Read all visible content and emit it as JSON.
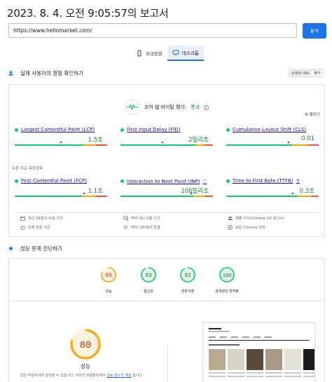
{
  "report": {
    "title": "2023. 8. 4. 오전 9:05:57의 보고서"
  },
  "url_input": {
    "value": "https://www.hellomarket.com/"
  },
  "analyze_label": "분석",
  "device_tabs": [
    {
      "label": "휴대전화",
      "icon": "smartphone-icon",
      "active": false
    },
    {
      "label": "데스크톱",
      "icon": "desktop-icon",
      "active": true
    }
  ],
  "real_user": {
    "title": "실제 사용자의 경험 확인하기",
    "toggle": [
      "요청된 URL",
      "출처"
    ],
    "cwv_label": "코어 웹 바이탈 평가:",
    "cwv_result": "통과",
    "expand": "뷰 펼치기",
    "other_label": "다른 주요 측정항목",
    "metrics": [
      {
        "name": "Largest Contentful Paint (LCP)",
        "value": "1.5초",
        "good": 0.75,
        "ni": 0.13,
        "poor": 0.12,
        "marker": 0.5
      },
      {
        "name": "First Input Delay (FID)",
        "value": "2밀리초",
        "good": 0.82,
        "ni": 0.09,
        "poor": 0.09,
        "marker": 0.46
      },
      {
        "name": "Cumulative Layout Shift (CLS)",
        "value": "0.01",
        "good": 0.71,
        "ni": 0.17,
        "poor": 0.12,
        "marker": 0.68
      },
      {
        "name": "First Contentful Paint (FCP)",
        "value": "1.1초",
        "good": 0.73,
        "ni": 0.14,
        "poor": 0.13,
        "marker": 0.75
      },
      {
        "name": "Interaction to Next Paint (INP)",
        "value": "106밀리초",
        "good": 0.79,
        "ni": 0.12,
        "poor": 0.09,
        "marker": 0.77
      },
      {
        "name": "Time to First Byte (TTFB)",
        "value": "0.3초",
        "good": 0.78,
        "ni": 0.14,
        "poor": 0.08,
        "marker": 0.72
      }
    ],
    "footer": [
      {
        "icon": "calendar-icon",
        "text": "최근 28일의 수집 기간"
      },
      {
        "icon": "devices-icon",
        "text": "여러 데스크톱 기기"
      },
      {
        "icon": "people-icon",
        "text": "샘플 다수(Chrome UX 보고서)"
      },
      {
        "icon": "timer-icon",
        "text": "전체 방문 시간"
      },
      {
        "icon": "wifi-icon",
        "text": "여러 네트워크 연결"
      },
      {
        "icon": "chrome-icon",
        "text": "모든 Chrome 버전"
      }
    ]
  },
  "diagnose": {
    "title": "성능 문제 진단하기",
    "gauges": [
      {
        "score": "80",
        "label": "성능",
        "color": "#c33300",
        "fill": 0.8,
        "ring": "#ffa400",
        "bg": "#fff3e0"
      },
      {
        "score": "93",
        "label": "접근성",
        "color": "#0d7a37",
        "fill": 0.93,
        "ring": "#0cce6b",
        "bg": "#e6f4ea"
      },
      {
        "score": "92",
        "label": "권장사항",
        "color": "#0d7a37",
        "fill": 0.92,
        "ring": "#0cce6b",
        "bg": "#e6f4ea"
      },
      {
        "score": "100",
        "label": "검색엔진 최적화",
        "color": "#0d7a37",
        "fill": 1.0,
        "ring": "#0cce6b",
        "bg": "#e6f4ea"
      }
    ],
    "big_score": "80",
    "big_fill": 0.8,
    "big_label": "성능",
    "desc_text": "값은 추정치이며 달라질 수 있습니다. 이러한 측정항목에서",
    "desc_link1": "성능 점수가 계산",
    "desc_link2": "됩니다."
  }
}
